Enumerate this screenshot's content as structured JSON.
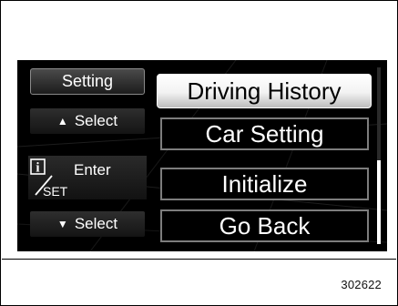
{
  "display": {
    "mode_title": "Setting",
    "hints": {
      "up_label": "Select",
      "up_icon": "up-triangle-icon",
      "enter_label": "Enter",
      "enter_icon": "info-set-button-icon",
      "enter_icon_top_glyph": "i",
      "enter_icon_bottom_text": "SET",
      "down_label": "Select",
      "down_icon": "down-triangle-icon"
    },
    "menu": {
      "items": [
        {
          "label": "Driving History",
          "selected": true
        },
        {
          "label": "Car Setting",
          "selected": false
        },
        {
          "label": "Initialize",
          "selected": false
        },
        {
          "label": "Go Back",
          "selected": false
        }
      ]
    },
    "scrollbar": {
      "position_fraction": 0.52
    }
  },
  "figure": {
    "number": "302622"
  },
  "colors": {
    "screen_background": "#000000",
    "text": "#ffffff",
    "selected_background": "#f2f2f2",
    "selected_text": "#000000",
    "menu_border": "#7d7d7d"
  }
}
